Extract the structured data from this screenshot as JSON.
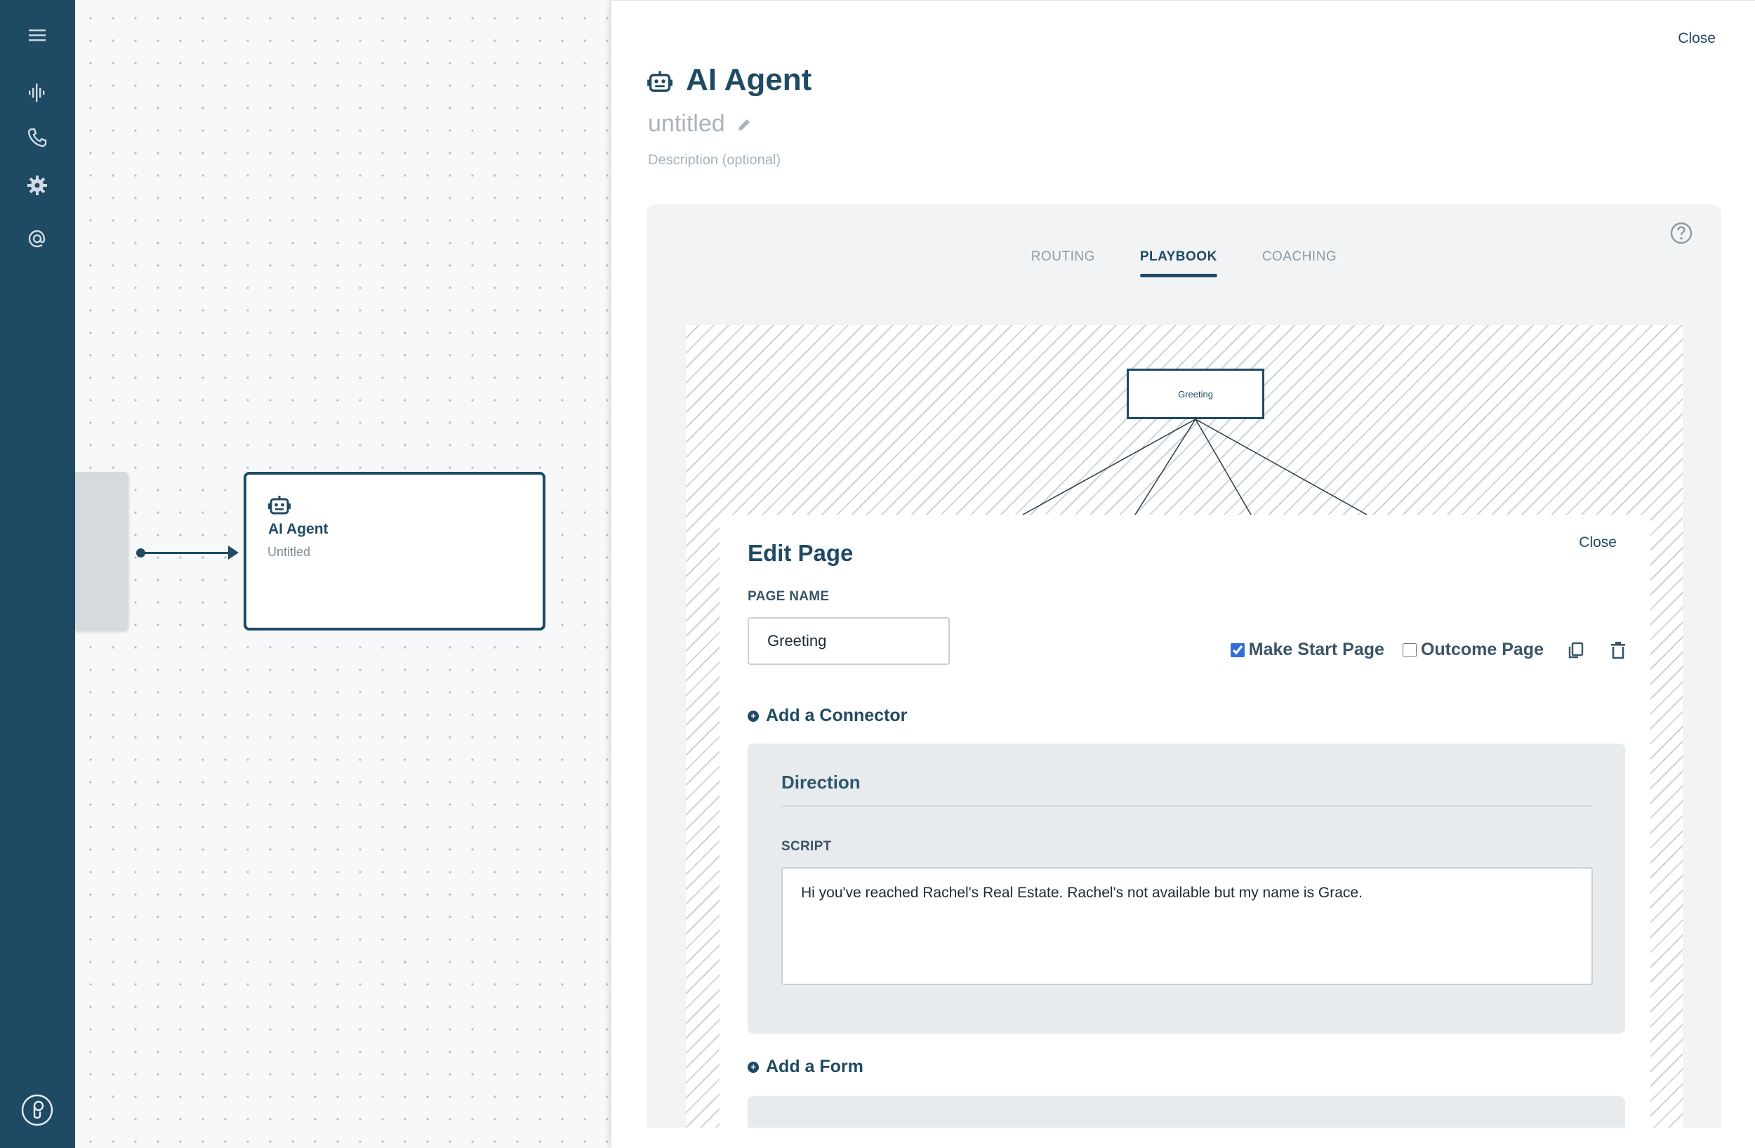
{
  "rail": {
    "icons": [
      "menu-icon",
      "waveform-icon",
      "phone-icon",
      "gear-icon",
      "at-sign-icon",
      "brand-logo-icon"
    ]
  },
  "canvas": {
    "node": {
      "title": "AI Agent",
      "subtitle": "Untitled"
    }
  },
  "panel": {
    "close_label": "Close",
    "title": "AI Agent",
    "subtitle": "untitled",
    "description_placeholder": "Description (optional)",
    "tabs": [
      {
        "label": "ROUTING",
        "active": false
      },
      {
        "label": "PLAYBOOK",
        "active": true
      },
      {
        "label": "COACHING",
        "active": false
      }
    ],
    "playbook": {
      "mini_node_label": "Greeting"
    },
    "edit_page": {
      "title": "Edit Page",
      "close_label": "Close",
      "page_name_label": "PAGE NAME",
      "page_name_value": "Greeting",
      "make_start_page_label": "Make Start Page",
      "make_start_page_checked": true,
      "outcome_page_label": "Outcome Page",
      "outcome_page_checked": false,
      "add_connector_label": "Add a Connector",
      "direction_title": "Direction",
      "script_label": "SCRIPT",
      "script_value": "Hi you've reached Rachel's Real Estate. Rachel's not available but my name is Grace.",
      "add_form_label": "Add a Form"
    }
  },
  "colors": {
    "primary": "#1f4a63",
    "muted": "#aab3ba",
    "checkbox": "#2f6fd6"
  }
}
